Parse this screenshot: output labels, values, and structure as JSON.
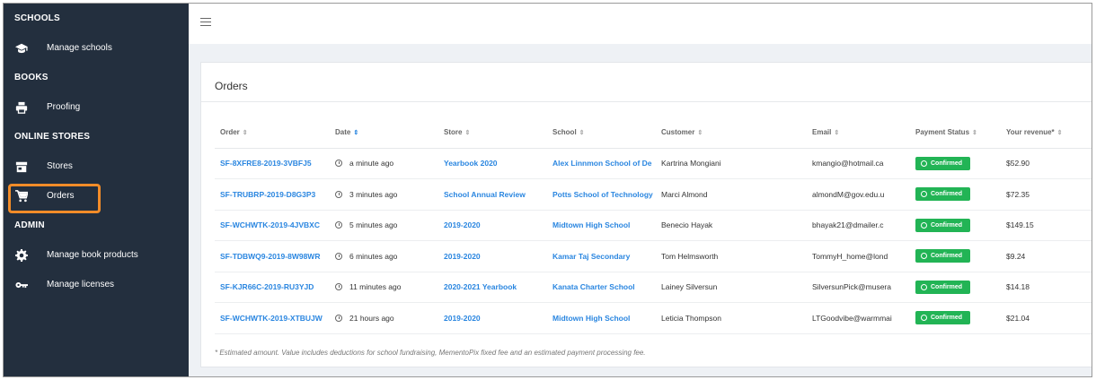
{
  "sidebar": {
    "sections": [
      {
        "title": "SCHOOLS",
        "items": [
          {
            "label": "Manage schools",
            "icon": "graduation-cap-icon"
          }
        ]
      },
      {
        "title": "BOOKS",
        "items": [
          {
            "label": "Proofing",
            "icon": "printer-icon"
          }
        ]
      },
      {
        "title": "ONLINE STORES",
        "items": [
          {
            "label": "Stores",
            "icon": "store-icon"
          },
          {
            "label": "Orders",
            "icon": "cart-icon"
          }
        ]
      },
      {
        "title": "ADMIN",
        "items": [
          {
            "label": "Manage book products",
            "icon": "gear-icon"
          },
          {
            "label": "Manage licenses",
            "icon": "key-icon"
          }
        ]
      }
    ]
  },
  "orders": {
    "title": "Orders",
    "columns": [
      "Order",
      "Date",
      "Store",
      "School",
      "Customer",
      "Email",
      "Payment Status",
      "Your revenue*"
    ],
    "rows": [
      {
        "order": "SF-8XFRE8-2019-3VBFJ5",
        "date": "a minute ago",
        "store": "Yearbook 2020",
        "school": "Alex Linnmon School of De",
        "customer": "Kartrina Mongiani",
        "email": "kmangio@hotmail.ca",
        "status": "Confirmed",
        "revenue": "$52.90"
      },
      {
        "order": "SF-TRUBRP-2019-D8G3P3",
        "date": "3 minutes ago",
        "store": "School Annual Review",
        "school": "Potts School of Technology",
        "customer": "Marci Almond",
        "email": "almondM@gov.edu.u",
        "status": "Confirmed",
        "revenue": "$72.35"
      },
      {
        "order": "SF-WCHWTK-2019-4JVBXC",
        "date": "5 minutes ago",
        "store": "2019-2020",
        "school": "Midtown High School",
        "customer": "Benecio Hayak",
        "email": "bhayak21@dmailer.c",
        "status": "Confirmed",
        "revenue": "$149.15"
      },
      {
        "order": "SF-TDBWQ9-2019-8W98WR",
        "date": "6 minutes ago",
        "store": "2019-2020",
        "school": "Kamar Taj Secondary",
        "customer": "Tom Helmsworth",
        "email": "TommyH_home@lond",
        "status": "Confirmed",
        "revenue": "$9.24"
      },
      {
        "order": "SF-KJR66C-2019-RU3YJD",
        "date": "11 minutes ago",
        "store": "2020-2021 Yearbook",
        "school": "Kanata Charter School",
        "customer": "Lainey Silversun",
        "email": "SilversunPick@musera",
        "status": "Confirmed",
        "revenue": "$14.18"
      },
      {
        "order": "SF-WCHWTK-2019-XTBUJW",
        "date": "21 hours ago",
        "store": "2019-2020",
        "school": "Midtown High School",
        "customer": "Leticia Thompson",
        "email": "LTGoodvibe@warmmai",
        "status": "Confirmed",
        "revenue": "$21.04"
      }
    ],
    "footnote": "* Estimated amount. Value includes deductions for school fundraising, MementoPix fixed fee and an estimated payment processing fee."
  },
  "colors": {
    "sidebar": "#232f3e",
    "link": "#2a86e0",
    "confirmed": "#22b455",
    "highlight": "#f28c28"
  }
}
